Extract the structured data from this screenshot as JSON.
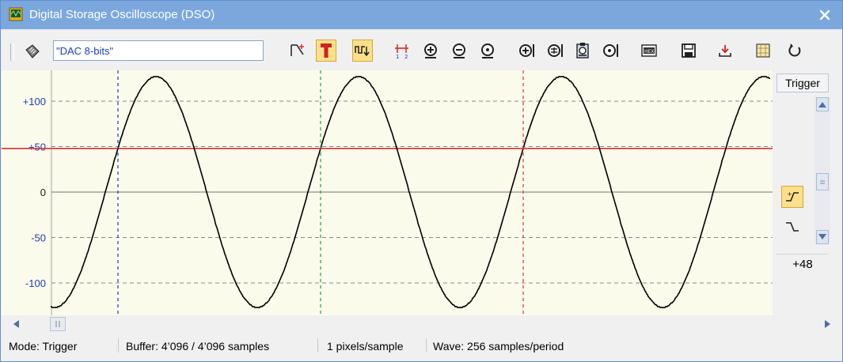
{
  "window": {
    "title": "Digital Storage Oscilloscope (DSO)"
  },
  "toolbar": {
    "source_value": "\"DAC 8-bits\"",
    "buttons": [
      {
        "name": "trigger-arm-icon"
      },
      {
        "name": "trigger-mode-icon",
        "active": true
      },
      {
        "name": "single-shot-icon",
        "active": true
      },
      {
        "name": "cursor-measure-icon"
      },
      {
        "name": "zoom-in-icon"
      },
      {
        "name": "zoom-out-icon"
      },
      {
        "name": "zoom-fit-icon"
      },
      {
        "name": "h-zoom-in-icon"
      },
      {
        "name": "h-zoom-full-icon"
      },
      {
        "name": "clipboard-copy-icon"
      },
      {
        "name": "h-zoom-out-icon"
      },
      {
        "name": "hex-view-icon"
      },
      {
        "name": "save-icon"
      },
      {
        "name": "export-icon"
      },
      {
        "name": "grid-toggle-icon"
      },
      {
        "name": "refresh-icon"
      }
    ]
  },
  "plot": {
    "y_ticks": [
      "+100",
      "+50",
      "0",
      "-50",
      "-100"
    ],
    "y_tick_values": [
      100,
      50,
      0,
      -50,
      -100
    ],
    "trigger_level": 48,
    "colors": {
      "waveform": "#000000",
      "trigger_line": "#e03030",
      "grid": "#888888",
      "cursor1": "#2030d0",
      "cursor2": "#20a040",
      "cursor3": "#e03030",
      "background": "#fbfbec"
    }
  },
  "chart_data": {
    "type": "line",
    "title": "",
    "xlabel": "",
    "ylabel": "",
    "ylim": [
      -128,
      127
    ],
    "samples_per_period": 256,
    "pixels_per_sample": 1,
    "amplitude": 127,
    "visible_samples": 910,
    "series": [
      {
        "values": []
      }
    ]
  },
  "side": {
    "trigger_label": "Trigger",
    "trigger_level_text": "+48",
    "rising_edge_active": true
  },
  "status": {
    "mode": "Mode: Trigger",
    "buffer": "Buffer:  4’096 / 4’096 samples",
    "resolution": "1 pixels/sample",
    "wave": "Wave: 256 samples/period"
  }
}
